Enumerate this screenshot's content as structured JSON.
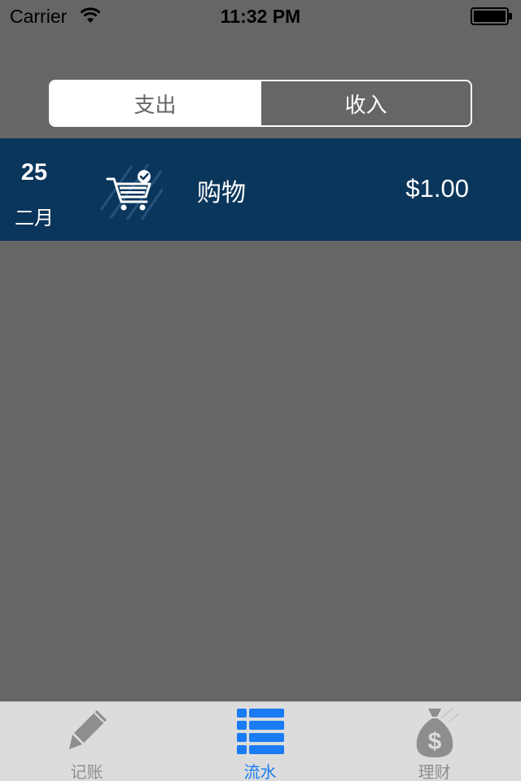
{
  "status_bar": {
    "carrier": "Carrier",
    "time": "11:32 PM",
    "wifi_icon": "wifi-icon",
    "battery_icon": "battery-icon"
  },
  "segmented_control": {
    "segments": [
      {
        "label": "支出",
        "selected": true
      },
      {
        "label": "收入",
        "selected": false
      }
    ]
  },
  "transactions": [
    {
      "day": "25",
      "month": "二月",
      "icon": "shopping-cart-icon",
      "category": "购物",
      "amount": "$1.00"
    }
  ],
  "tab_bar": {
    "tabs": [
      {
        "label": "记账",
        "icon": "pencil-icon",
        "active": false
      },
      {
        "label": "流水",
        "icon": "list-icon",
        "active": true
      },
      {
        "label": "理财",
        "icon": "money-bag-icon",
        "active": false
      }
    ]
  },
  "colors": {
    "background": "#666666",
    "row_background": "#0b365c",
    "tab_bar": "#dcdcdc",
    "tab_active": "#1a7cf5",
    "tab_inactive": "#8e8e8e"
  }
}
